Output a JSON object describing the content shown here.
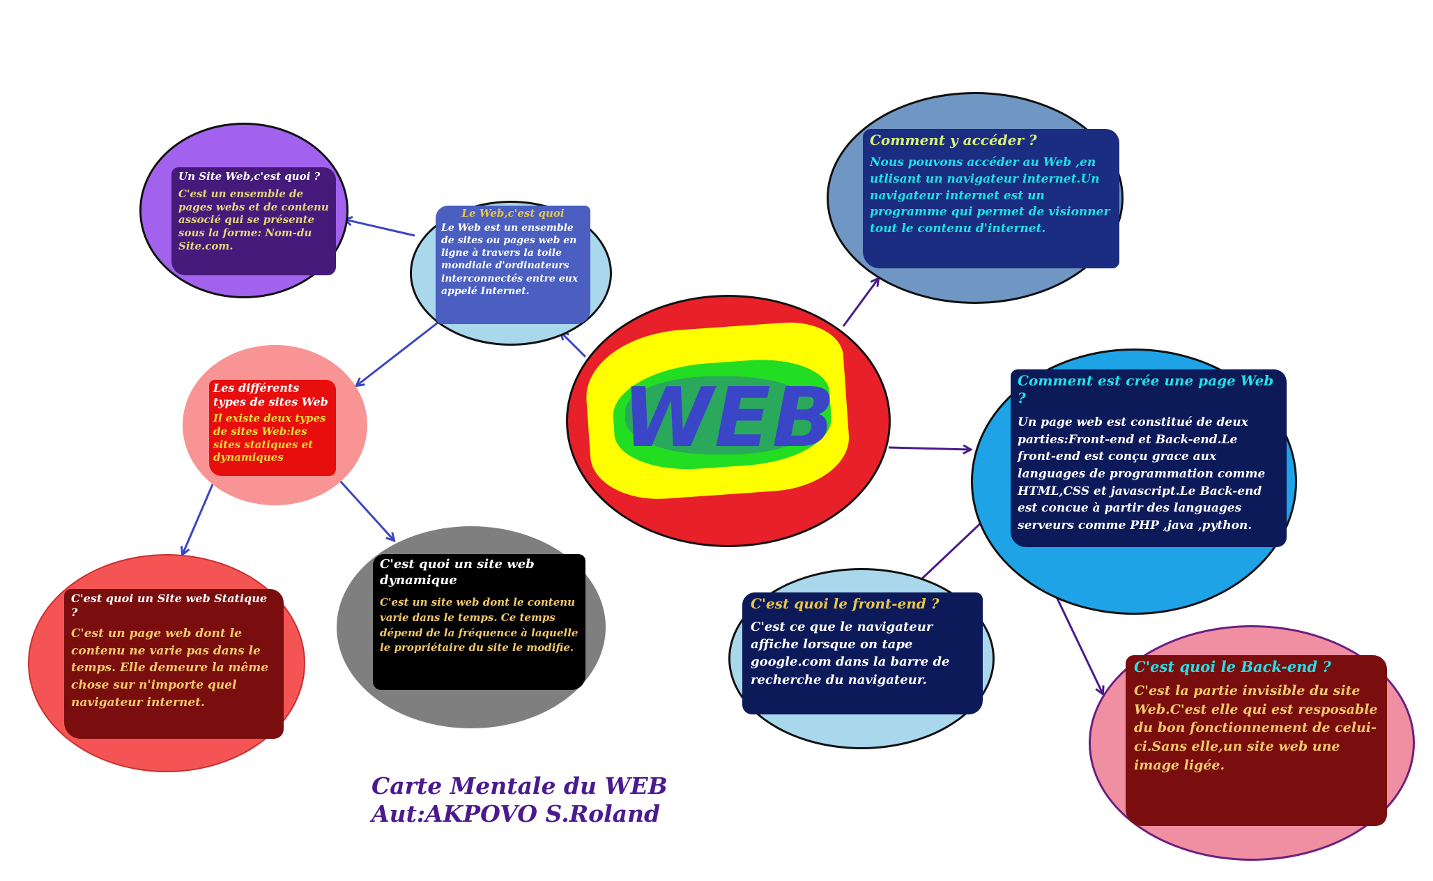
{
  "center": {
    "label": "WEB"
  },
  "nodes": {
    "web_quoi": {
      "title": "Le Web,c'est quoi",
      "text": "Le Web est un ensemble de sites ou pages web en ligne à travers la toile mondiale d'ordinateurs interconnectés entre eux appelé Internet."
    },
    "site_web": {
      "title": "Un Site Web,c'est quoi ?",
      "text": "C'est un ensemble de pages webs et de contenu associé qui se présente sous la forme: Nom-du Site.com."
    },
    "types": {
      "title": "Les différents types de sites Web",
      "text": "Il existe deux types de sites Web:les sites statiques et dynamiques"
    },
    "statique": {
      "title": "C'est quoi un Site web Statique ?",
      "text": "C'est un page web dont le contenu ne varie pas dans le temps. Elle demeure la même chose sur n'importe quel navigateur internet."
    },
    "dynamique": {
      "title": "C'est quoi un site web dynamique",
      "text": "C'est un site web dont le contenu varie dans le temps. Ce temps dépend de la fréquence à laquelle le propriétaire du site le modifie."
    },
    "acceder": {
      "title": "Comment y accéder ?",
      "text": "Nous pouvons accéder au Web ,en utlisant un navigateur internet.Un navigateur internet est un programme qui permet de visionner tout le contenu d'internet."
    },
    "creation": {
      "title": "Comment est crée une page Web ?",
      "text": "Un page web est constitué de deux parties:Front-end et Back-end.Le front-end est conçu grace aux languages de programmation comme HTML,CSS et javascript.Le Back-end est concue à partir des languages serveurs comme PHP ,java ,python."
    },
    "frontend": {
      "title": "C'est quoi le front-end ?",
      "text": "C'est ce que le navigateur affiche lorsque on tape google.com dans la barre de recherche du navigateur."
    },
    "backend": {
      "title": "C'est quoi le Back-end ?",
      "text": "C'est la partie invisible du site Web.C'est elle qui est resposable du bon fonctionnement de celui-ci.Sans elle,un site web une image ligée."
    }
  },
  "footer": {
    "line1": "Carte Mentale du WEB",
    "line2": "Aut:AKPOVO S.Roland"
  },
  "colors": {
    "center_fill": "#e8202a",
    "center_ring": "#ffff00",
    "center_inner": "#22dd22",
    "arrow_blue": "#3b44c4",
    "arrow_purple": "#4a1a8a"
  }
}
